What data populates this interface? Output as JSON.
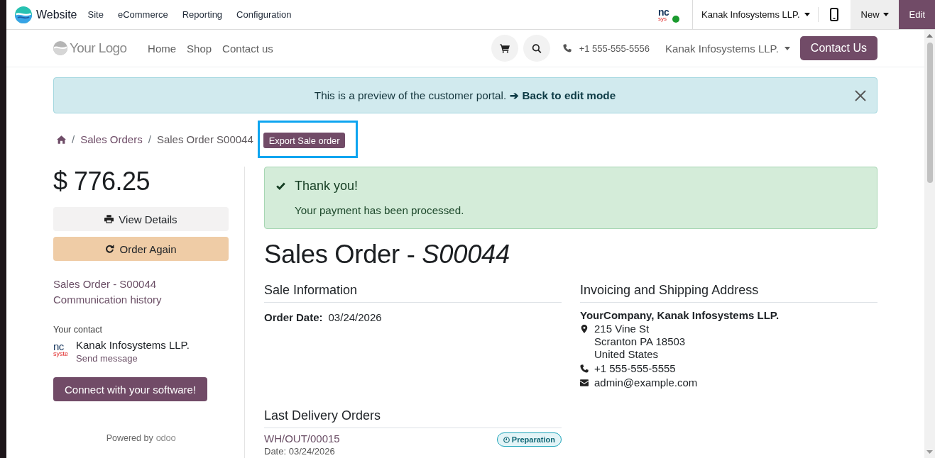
{
  "top_bar": {
    "app_name": "Website",
    "menu": [
      "Site",
      "eCommerce",
      "Reporting",
      "Configuration"
    ],
    "company_logo": [
      "nc",
      "sys"
    ],
    "company": "Kanak Infosystems LLP.",
    "new_button": "New",
    "edit_button": "Edit"
  },
  "site_header": {
    "logo": "Your Logo",
    "nav": [
      "Home",
      "Shop",
      "Contact us"
    ],
    "phone": "+1 555-555-5556",
    "company": "Kanak Infosystems LLP.",
    "contact_button": "Contact Us"
  },
  "preview_banner": {
    "text": "This is a preview of the customer portal.",
    "link": "➔ Back to edit mode"
  },
  "breadcrumb": {
    "items": [
      {
        "kind": "home"
      },
      {
        "kind": "separator",
        "text": "/"
      },
      {
        "kind": "link",
        "text": "Sales Orders"
      },
      {
        "kind": "separator",
        "text": "/"
      },
      {
        "kind": "current",
        "text": "Sales Order S00044"
      }
    ],
    "export_button": "Export Sale order",
    "highlighted": true
  },
  "sidebar": {
    "amount": "$ 776.25",
    "buttons": [
      {
        "kind": "print",
        "label": "View Details"
      },
      {
        "kind": "reorder",
        "label": "Order Again"
      }
    ],
    "links": [
      "Sales Order - S00044",
      "Communication history"
    ],
    "contact": {
      "heading": "Your contact",
      "logo": [
        "nc",
        "syste"
      ],
      "name": "Kanak Infosystems LLP.",
      "action": "Send message"
    },
    "connect_button": "Connect with your software!",
    "powered_by": {
      "text": "Powered by",
      "brand": "odoo"
    }
  },
  "order": {
    "alert": {
      "title": "Thank you!",
      "message": "Your payment has been processed."
    },
    "title": "Sales Order - *S00044*",
    "sale_information": {
      "heading": "Sale Information",
      "fields": [
        {
          "label": "Order Date:",
          "value": "03/24/2026"
        }
      ]
    },
    "address": {
      "heading": "Invoicing and Shipping Address",
      "name": "YourCompany, Kanak Infosystems LLP.",
      "items": [
        {
          "kind": "address",
          "lines": [
            "215 Vine St",
            "Scranton PA 18503",
            "United States"
          ]
        },
        {
          "kind": "phone",
          "lines": [
            "+1 555-555-5555"
          ]
        },
        {
          "kind": "email",
          "lines": [
            "admin@example.com"
          ]
        }
      ]
    },
    "deliveries": {
      "heading": "Last Delivery Orders",
      "orders": [
        {
          "reference": "WH/OUT/00015",
          "status": "Preparation",
          "date": "Date: 03/24/2026"
        }
      ]
    }
  }
}
